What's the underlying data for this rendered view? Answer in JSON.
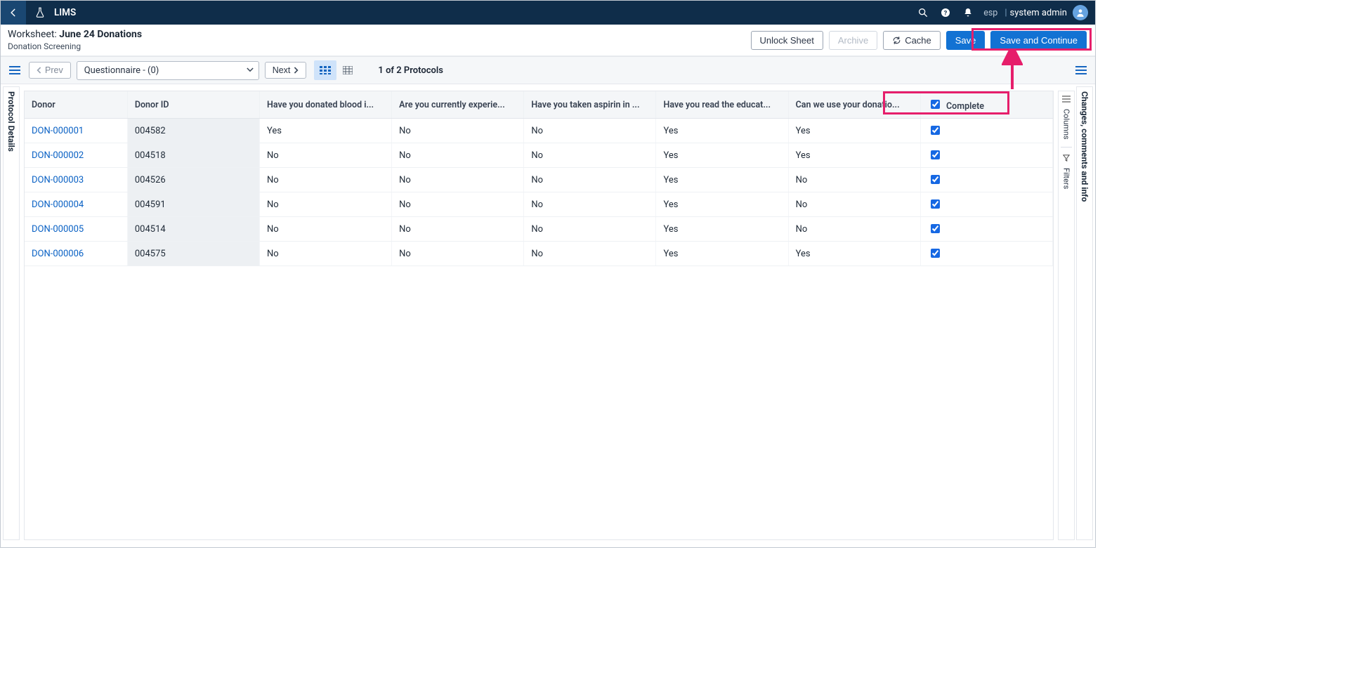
{
  "topbar": {
    "app_name": "LIMS",
    "tenant": "esp",
    "username": "system admin"
  },
  "subheader": {
    "worksheet_label": "Worksheet: ",
    "worksheet_name": "June 24 Donations",
    "subtitle": "Donation Screening",
    "btn_unlock": "Unlock Sheet",
    "btn_archive": "Archive",
    "btn_cache": "Cache",
    "btn_save": "Save",
    "btn_save_continue": "Save and Continue"
  },
  "toolbar": {
    "prev": "Prev",
    "next": "Next",
    "select_value": "Questionnaire - (0)",
    "protocol_count": "1 of 2 Protocols"
  },
  "rails": {
    "left": "Protocol Details",
    "right": "Changes, comments and info",
    "columns": "Columns",
    "filters": "Filters"
  },
  "table": {
    "headers": {
      "donor": "Donor",
      "donor_id": "Donor ID",
      "q1": "Have you donated blood i...",
      "q2": "Are you currently experie...",
      "q3": "Have you taken aspirin in ...",
      "q4": "Have you read the educat...",
      "q5": "Can we use your donatio...",
      "complete": "Complete"
    },
    "rows": [
      {
        "donor": "DON-000001",
        "donor_id": "004582",
        "q1": "Yes",
        "q2": "No",
        "q3": "No",
        "q4": "Yes",
        "q5": "Yes",
        "complete": true
      },
      {
        "donor": "DON-000002",
        "donor_id": "004518",
        "q1": "No",
        "q2": "No",
        "q3": "No",
        "q4": "Yes",
        "q5": "Yes",
        "complete": true
      },
      {
        "donor": "DON-000003",
        "donor_id": "004526",
        "q1": "No",
        "q2": "No",
        "q3": "No",
        "q4": "Yes",
        "q5": "No",
        "complete": true
      },
      {
        "donor": "DON-000004",
        "donor_id": "004591",
        "q1": "No",
        "q2": "No",
        "q3": "No",
        "q4": "Yes",
        "q5": "No",
        "complete": true
      },
      {
        "donor": "DON-000005",
        "donor_id": "004514",
        "q1": "No",
        "q2": "No",
        "q3": "No",
        "q4": "Yes",
        "q5": "No",
        "complete": true
      },
      {
        "donor": "DON-000006",
        "donor_id": "004575",
        "q1": "No",
        "q2": "No",
        "q3": "No",
        "q4": "Yes",
        "q5": "Yes",
        "complete": true
      }
    ]
  }
}
